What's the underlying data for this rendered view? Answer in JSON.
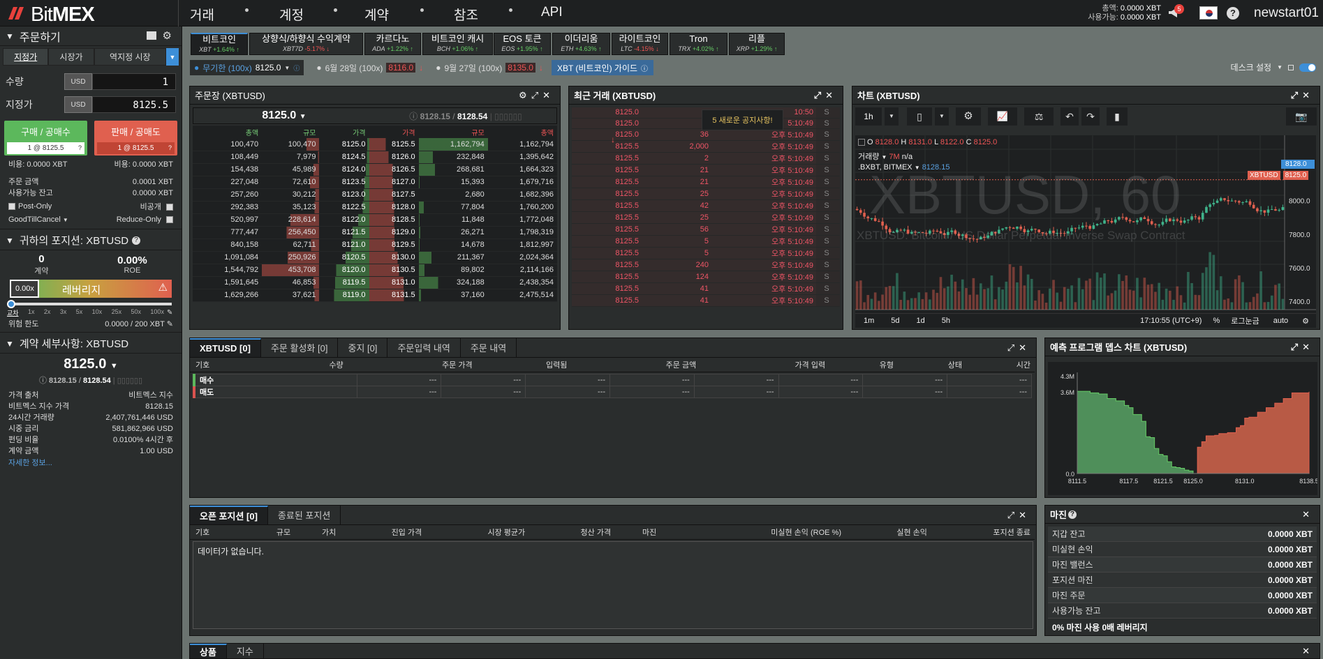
{
  "topbar": {
    "brand_a": "Bit",
    "brand_b": "MEX",
    "nav": [
      "거래",
      "계정",
      "계약",
      "참조",
      "API"
    ],
    "balance_label": "총액:",
    "balance_value": "0.0000 XBT",
    "available_label": "사용가능:",
    "available_value": "0.0000 XBT",
    "notif_count": "5",
    "username": "newstart01"
  },
  "order": {
    "title": "주문하기",
    "tabs": [
      "지정가",
      "시장가",
      "역지정 시장"
    ],
    "qty_label": "수량",
    "qty_unit": "USD",
    "qty_value": "1",
    "price_label": "지정가",
    "price_unit": "USD",
    "price_value": "8125.5",
    "buy_label": "구매 / 공매수",
    "buy_sub": "1 @ 8125.5",
    "sell_label": "판매 / 공매도",
    "sell_sub": "1 @ 8125.5",
    "buy_cost": "비용: 0.0000 XBT",
    "sell_cost": "비용: 0.0000 XBT",
    "order_value_label": "주문 금액",
    "order_value": "0.0001 XBT",
    "avail_label": "사용가능 잔고",
    "avail_value": "0.0000 XBT",
    "post_only": "Post-Only",
    "hidden": "비공개",
    "tif": "GoodTillCancel",
    "reduce_only": "Reduce-Only"
  },
  "position": {
    "title": "귀하의 포지션: XBTUSD",
    "contracts": "0",
    "contracts_label": "계약",
    "roe": "0.00%",
    "roe_label": "ROE",
    "lev_value": "0.00x",
    "lev_label": "레버리지",
    "slider_labels": [
      "교차",
      "1x",
      "2x",
      "3x",
      "5x",
      "10x",
      "25x",
      "50x",
      "100x"
    ],
    "risk_label": "위험 한도",
    "risk_value": "0.0000 / 200 XBT"
  },
  "contract": {
    "title": "계약 세부사항: XBTUSD",
    "price": "8125.0",
    "index_a": "8128.15",
    "index_b": "8128.54",
    "rows": [
      {
        "k": "가격 출처",
        "v": "비트멕스 지수"
      },
      {
        "k": "비트멕스 지수 가격",
        "v": "8128.15"
      },
      {
        "k": "24시간 거래량",
        "v": "2,407,761,446 USD"
      },
      {
        "k": "시중 금리",
        "v": "581,862,966 USD"
      },
      {
        "k": "펀딩 비율",
        "v": "0.0100% 4시간 후"
      },
      {
        "k": "계약 금액",
        "v": "1.00 USD"
      }
    ],
    "more": "자세한 정보..."
  },
  "instruments": [
    {
      "name": "비트코인",
      "sym": "XBT",
      "chg": "+1.64%",
      "dir": "up"
    },
    {
      "name": "상향식/하향식 수익계약",
      "sym": "XBT7D",
      "chg": "-5.17%",
      "dir": "dn"
    },
    {
      "name": "카르다노",
      "sym": "ADA",
      "chg": "+1.22%",
      "dir": "up"
    },
    {
      "name": "비트코인 캐시",
      "sym": "BCH",
      "chg": "+1.06%",
      "dir": "up"
    },
    {
      "name": "EOS 토큰",
      "sym": "EOS",
      "chg": "+1.95%",
      "dir": "up"
    },
    {
      "name": "이더리움",
      "sym": "ETH",
      "chg": "+4.63%",
      "dir": "up"
    },
    {
      "name": "라이트코인",
      "sym": "LTC",
      "chg": "-4.15%",
      "dir": "dn"
    },
    {
      "name": "Tron",
      "sym": "TRX",
      "chg": "+4.02%",
      "dir": "up"
    },
    {
      "name": "리플",
      "sym": "XRP",
      "chg": "+1.29%",
      "dir": "up"
    }
  ],
  "subbar": {
    "perp_label": "무기한 (100x)",
    "perp_price": "8125.0",
    "jun_label": "6월 28일 (100x)",
    "jun_price": "8116.0",
    "sep_label": "9월 27일 (100x)",
    "sep_price": "8135.0",
    "guide": "XBT (비트코인) 가이드",
    "desk": "데스크 설정"
  },
  "orderbook": {
    "title": "주문장 (XBTUSD)",
    "last": "8125.0",
    "idx_a": "8128.15",
    "idx_b": "8128.54",
    "headers": [
      "총액",
      "규모",
      "가격",
      "가격",
      "규모",
      "총액"
    ],
    "rows": [
      [
        "100,470",
        "100,470",
        "8125.0",
        "8125.5",
        "1,162,794",
        "1,162,794"
      ],
      [
        "108,449",
        "7,979",
        "8124.5",
        "8126.0",
        "232,848",
        "1,395,642"
      ],
      [
        "154,438",
        "45,989",
        "8124.0",
        "8126.5",
        "268,681",
        "1,664,323"
      ],
      [
        "227,048",
        "72,610",
        "8123.5",
        "8127.0",
        "15,393",
        "1,679,716"
      ],
      [
        "257,260",
        "30,212",
        "8123.0",
        "8127.5",
        "2,680",
        "1,682,396"
      ],
      [
        "292,383",
        "35,123",
        "8122.5",
        "8128.0",
        "77,804",
        "1,760,200"
      ],
      [
        "520,997",
        "228,614",
        "8122.0",
        "8128.5",
        "11,848",
        "1,772,048"
      ],
      [
        "777,447",
        "256,450",
        "8121.5",
        "8129.0",
        "26,271",
        "1,798,319"
      ],
      [
        "840,158",
        "62,711",
        "8121.0",
        "8129.5",
        "14,678",
        "1,812,997"
      ],
      [
        "1,091,084",
        "250,926",
        "8120.5",
        "8130.0",
        "211,367",
        "2,024,364"
      ],
      [
        "1,544,792",
        "453,708",
        "8120.0",
        "8130.5",
        "89,802",
        "2,114,166"
      ],
      [
        "1,591,645",
        "46,853",
        "8119.5",
        "8131.0",
        "324,188",
        "2,438,354"
      ],
      [
        "1,629,266",
        "37,621",
        "8119.0",
        "8131.5",
        "37,160",
        "2,475,514"
      ]
    ]
  },
  "trades": {
    "title": "최근 거래 (XBTUSD)",
    "notice": "5 새로운 공지사항!",
    "rows": [
      [
        "8125.0",
        "",
        "10:50",
        "S"
      ],
      [
        "8125.0",
        "",
        "5:10:49",
        "S"
      ],
      [
        "8125.0",
        "36",
        "오후 5:10:49",
        "S"
      ],
      [
        "8125.5",
        "2,000",
        "오후 5:10:49",
        "S"
      ],
      [
        "8125.5",
        "2",
        "오후 5:10:49",
        "S"
      ],
      [
        "8125.5",
        "21",
        "오후 5:10:49",
        "S"
      ],
      [
        "8125.5",
        "21",
        "오후 5:10:49",
        "S"
      ],
      [
        "8125.5",
        "25",
        "오후 5:10:49",
        "S"
      ],
      [
        "8125.5",
        "42",
        "오후 5:10:49",
        "S"
      ],
      [
        "8125.5",
        "25",
        "오후 5:10:49",
        "S"
      ],
      [
        "8125.5",
        "56",
        "오후 5:10:49",
        "S"
      ],
      [
        "8125.5",
        "5",
        "오후 5:10:49",
        "S"
      ],
      [
        "8125.5",
        "5",
        "오후 5:10:49",
        "S"
      ],
      [
        "8125.5",
        "240",
        "오후 5:10:49",
        "S"
      ],
      [
        "8125.5",
        "124",
        "오후 5:10:49",
        "S"
      ],
      [
        "8125.5",
        "41",
        "오후 5:10:49",
        "S"
      ],
      [
        "8125.5",
        "41",
        "오후 5:10:49",
        "S"
      ]
    ]
  },
  "chart": {
    "title": "차트 (XBTUSD)",
    "interval": "1h",
    "ohlc_o": "8128.0",
    "ohlc_h": "8131.0",
    "ohlc_l": "8122.0",
    "ohlc_c": "8125.0",
    "vol_label": "거래량",
    "vol_value": "7M",
    "vol_na": "n/a",
    "idx_label": ".BXBT, BITMEX",
    "idx_value": "8128.15",
    "watermark": "XBTUSD, 60",
    "watermark_sub": "XBTUSD: Bitcoin / US Dollar Perpetual Inverse Swap Contract",
    "y_ticks": [
      "8000.0",
      "7800.0",
      "7600.0",
      "7400.0"
    ],
    "tag_blue": "8128.0",
    "tag_label": "XBTUSD",
    "tag_red": "8125.0",
    "x_ticks": [
      "10",
      "11",
      "12",
      "13",
      "15:00"
    ],
    "ranges": [
      "1m",
      "5d",
      "1d",
      "5h"
    ],
    "time": "17:10:55 (UTC+9)",
    "pct": "%",
    "log": "로그눈금",
    "auto": "auto"
  },
  "orders": {
    "tabs": [
      "XBTUSD [0]",
      "주문 활성화 [0]",
      "중지 [0]",
      "주문입력 내역",
      "주문 내역"
    ],
    "headers": [
      "기호",
      "수량",
      "주문 가격",
      "입력됨",
      "주문 금액",
      "가격 입력",
      "유형",
      "상태",
      "시간"
    ],
    "rows": [
      [
        "매수",
        "---",
        "---",
        "---",
        "---",
        "---",
        "---",
        "---",
        "---"
      ],
      [
        "매도",
        "---",
        "---",
        "---",
        "---",
        "---",
        "---",
        "---",
        "---"
      ]
    ]
  },
  "depth": {
    "title": "예측 프로그램 뎁스 차트 (XBTUSD)",
    "y_ticks": [
      "4.3M",
      "3.6M",
      "0.0"
    ],
    "x_ticks": [
      "8111.5",
      "8117.5",
      "8121.5",
      "8125.0",
      "8131.0",
      "8138.5"
    ]
  },
  "positions": {
    "tabs": [
      "오픈 포지션 [0]",
      "종료된 포지션"
    ],
    "headers": [
      "기호",
      "규모",
      "가치",
      "진입 가격",
      "시장 평균가",
      "청산 가격",
      "마진",
      "미실현 손익 (ROE %)",
      "실현 손익",
      "포지션 종료"
    ],
    "empty": "데이터가 없습니다."
  },
  "margin": {
    "title": "마진",
    "rows": [
      {
        "k": "지갑 잔고",
        "v": "0.0000 XBT"
      },
      {
        "k": "미실현 손익",
        "v": "0.0000 XBT"
      },
      {
        "k": "마진 밸런스",
        "v": "0.0000 XBT"
      },
      {
        "k": "포지션 마진",
        "v": "0.0000 XBT"
      },
      {
        "k": "마진 주문",
        "v": "0.0000 XBT"
      },
      {
        "k": "사용가능 잔고",
        "v": "0.0000 XBT"
      }
    ],
    "footer": "0% 마진 사용 0배 레버리지"
  },
  "bottom": {
    "tabs": [
      "상품",
      "지수"
    ]
  },
  "colors": {
    "buy": "#5cb85c",
    "sell": "#d9534f",
    "accent": "#3d8fd8",
    "bg": "#6b7370"
  }
}
